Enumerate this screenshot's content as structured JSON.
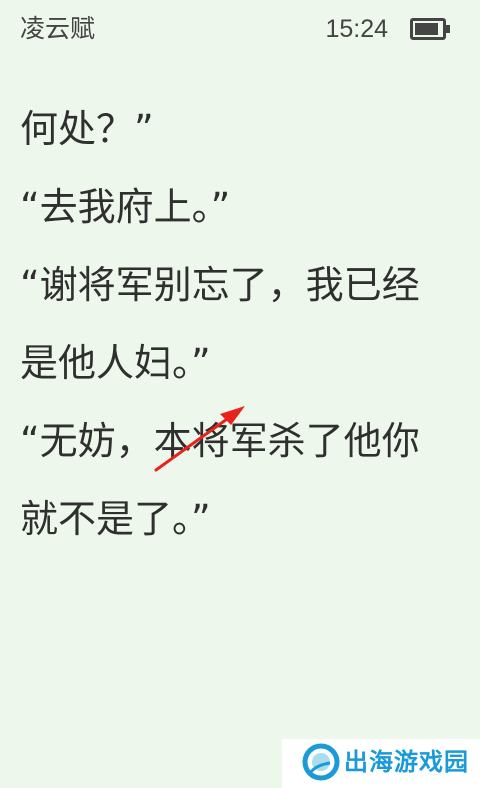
{
  "status_bar": {
    "book_title": "凌云赋",
    "time": "15:24",
    "battery_level": 0.88
  },
  "content": {
    "lines": [
      "何处？”",
      "“去我府上。”",
      "“谢将军别忘了，我已经",
      "是他人妇。”",
      "“无妨，本将军杀了他你",
      "就不是了。”"
    ]
  },
  "annotation": {
    "icon": "red-arrow-icon",
    "color": "#e8231c"
  },
  "watermark": {
    "text": "出海游戏园",
    "icon": "logo-icon",
    "color": "#1a9bd8"
  },
  "colors": {
    "background": "#eef7ec",
    "text": "#2f2f2f"
  }
}
